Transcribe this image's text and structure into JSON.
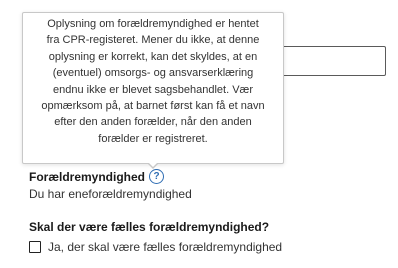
{
  "tooltip": {
    "lines": [
      "Oplysning om forældremyndighed er hentet",
      "fra CPR-registeret. Mener du ikke, at denne",
      "oplysning er korrekt, kan det skyldes, at en",
      "(eventuel) omsorgs- og ansvarserklæring",
      "endnu ikke er blevet sagsbehandlet. Vær",
      "opmærksom på, at barnet først kan få et navn",
      "efter den anden forælder, når den anden",
      "forælder er registreret."
    ]
  },
  "input": {
    "value": ""
  },
  "custody": {
    "label": "Forældremyndighed",
    "help_icon": "?",
    "value": "Du har eneforældremyndighed"
  },
  "joint_custody": {
    "question": "Skal der være fælles forældremyndighed?",
    "checkbox_label": "Ja, der skal være fælles forældremyndighed",
    "checked": false
  },
  "colors": {
    "accent": "#2f6db3",
    "text": "#1a1a1a"
  }
}
